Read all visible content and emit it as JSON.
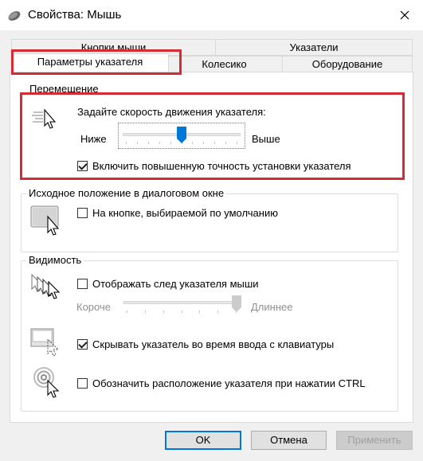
{
  "window": {
    "title": "Свойства: Мышь",
    "icon": "mouse-icon"
  },
  "tabs": {
    "row1": [
      "Кнопки мыши",
      "Указатели"
    ],
    "row2": [
      "Параметры указателя",
      "Колесико",
      "Оборудование"
    ],
    "selected": "Параметры указателя"
  },
  "motion": {
    "group_label": "Перемещение",
    "speed_label": "Задайте скорость движения указателя:",
    "slow_label": "Ниже",
    "fast_label": "Выше",
    "speed_level": 0.5,
    "precision_label": "Включить повышенную точность установки указателя",
    "precision_checked": true
  },
  "snap_to": {
    "group_label": "Исходное положение в диалоговом окне",
    "checkbox_label": "На кнопке, выбираемой по умолчанию",
    "checked": false
  },
  "visibility": {
    "group_label": "Видимость",
    "trails_label": "Отображать след указателя мыши",
    "trails_checked": false,
    "short_label": "Короче",
    "long_label": "Длиннее",
    "trails_level": 1.0,
    "hide_label": "Скрывать указатель во время ввода с клавиатуры",
    "hide_checked": true,
    "ctrl_label": "Обозначить расположение указателя при нажатии CTRL",
    "ctrl_checked": false
  },
  "buttons": {
    "ok": "OK",
    "cancel": "Отмена",
    "apply": "Применить"
  },
  "colors": {
    "highlight": "#d62b35",
    "slider_thumb": "#0078d7"
  }
}
